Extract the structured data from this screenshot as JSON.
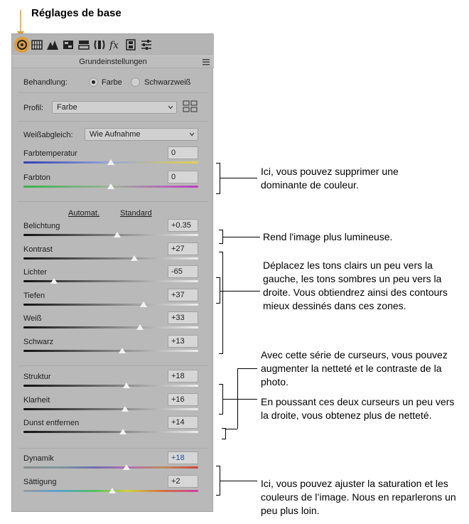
{
  "page_title": "Réglages de base",
  "colors": {
    "accent": "#e59a2c",
    "panel_bg": "#b9b9b9"
  },
  "toolbar": {
    "icons": [
      "basic-panel-icon",
      "tone-curve-icon",
      "detail-icon",
      "hsl-icon",
      "split-toning-icon",
      "lens-icon",
      "effects-icon",
      "calibration-icon",
      "presets-icon"
    ]
  },
  "panel": {
    "section_title": "Grundeinstellungen",
    "treatment": {
      "label": "Behandlung:",
      "option_color": "Farbe",
      "option_bw": "Schwarzweiß",
      "selected": "Farbe"
    },
    "profile": {
      "label": "Profil:",
      "value": "Farbe"
    },
    "white_balance": {
      "label": "Weißabgleich:",
      "value": "Wie Aufnahme"
    },
    "auto_link": "Automat.",
    "default_link": "Standard",
    "sliders": [
      {
        "label": "Farbtemperatur",
        "value": "0",
        "level": 0.5
      },
      {
        "label": "Farbton",
        "value": "0",
        "level": 0.5
      },
      {
        "label": "Belichtung",
        "value": "+0.35",
        "level": 0.535
      },
      {
        "label": "Kontrast",
        "value": "+27",
        "level": 0.635
      },
      {
        "label": "Lichter",
        "value": "-65",
        "level": 0.175
      },
      {
        "label": "Tiefen",
        "value": "+37",
        "level": 0.685
      },
      {
        "label": "Weiß",
        "value": "+33",
        "level": 0.665
      },
      {
        "label": "Schwarz",
        "value": "+13",
        "level": 0.565
      },
      {
        "label": "Struktur",
        "value": "+18",
        "level": 0.59
      },
      {
        "label": "Klarheit",
        "value": "+16",
        "level": 0.58
      },
      {
        "label": "Dunst entfernen",
        "value": "+14",
        "level": 0.57
      },
      {
        "label": "Dynamik",
        "value": "+18",
        "level": 0.59
      },
      {
        "label": "Sättigung",
        "value": "+2",
        "level": 0.51
      }
    ]
  },
  "annotations": {
    "wb": "Ici, vous pouvez supprimer une dominante de couleur.",
    "exposure": "Rend l'image plus lumineuse.",
    "tones": "Déplacez les tons clairs un peu vers la gauche, les tons sombres un peu vers la droite. Vous obtiendrez ainsi des contours mieux dessinés dans ces zones.",
    "presence": "Avec cette série de curseurs, vous pouvez augmenter la netteté et le contraste de la photo.",
    "sharpen": "En poussant ces deux curseurs un peu vers la droite, vous obtenez plus de netteté.",
    "saturation": "Ici, vous pouvez ajuster la saturation et les couleurs de l’image. Nous en reparlerons un peu plus loin."
  }
}
